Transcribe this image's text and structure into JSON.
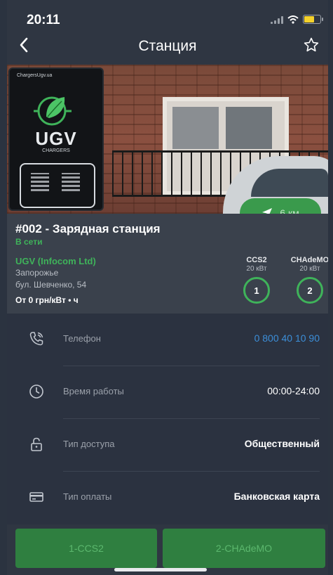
{
  "status_bar": {
    "time": "20:11",
    "battery_color": "#f5d22b"
  },
  "header": {
    "title": "Станция",
    "back_icon": "chevron-left-icon",
    "favorite_icon": "star-outline-icon"
  },
  "photo": {
    "sign_top_text": "ChargersUgv.ua",
    "sign_brand": "UGV",
    "sign_sub": "CHARGERS"
  },
  "distance": {
    "label": "6 км"
  },
  "station": {
    "name": "#002 - Зарядная станция",
    "status": "В сети",
    "company": "UGV (Infocom Ltd)",
    "city": "Запорожье",
    "address": "бул. Шевченко, 54",
    "price": "От 0 грн/кВт • ч",
    "connectors": [
      {
        "type": "CCS2",
        "power": "20 кВт",
        "number": "1"
      },
      {
        "type": "CHAdeMO",
        "power": "20 кВт",
        "number": "2"
      }
    ]
  },
  "details": [
    {
      "label": "Телефон",
      "value": "0 800 40 10 90",
      "icon": "phone-icon"
    },
    {
      "label": "Время работы",
      "value": "00:00-24:00",
      "icon": "clock-icon"
    },
    {
      "label": "Тип доступа",
      "value": "Общественный",
      "icon": "lock-icon"
    },
    {
      "label": "Тип оплаты",
      "value": "Банковская карта",
      "icon": "credit-card-icon"
    }
  ],
  "bottom_buttons": [
    "1-CCS2",
    "2-CHAdeMO"
  ],
  "colors": {
    "accent_green": "#3fb35a",
    "button_green": "#2f7f40",
    "phone_blue": "#3c8ed8",
    "background": "#2b3240"
  }
}
